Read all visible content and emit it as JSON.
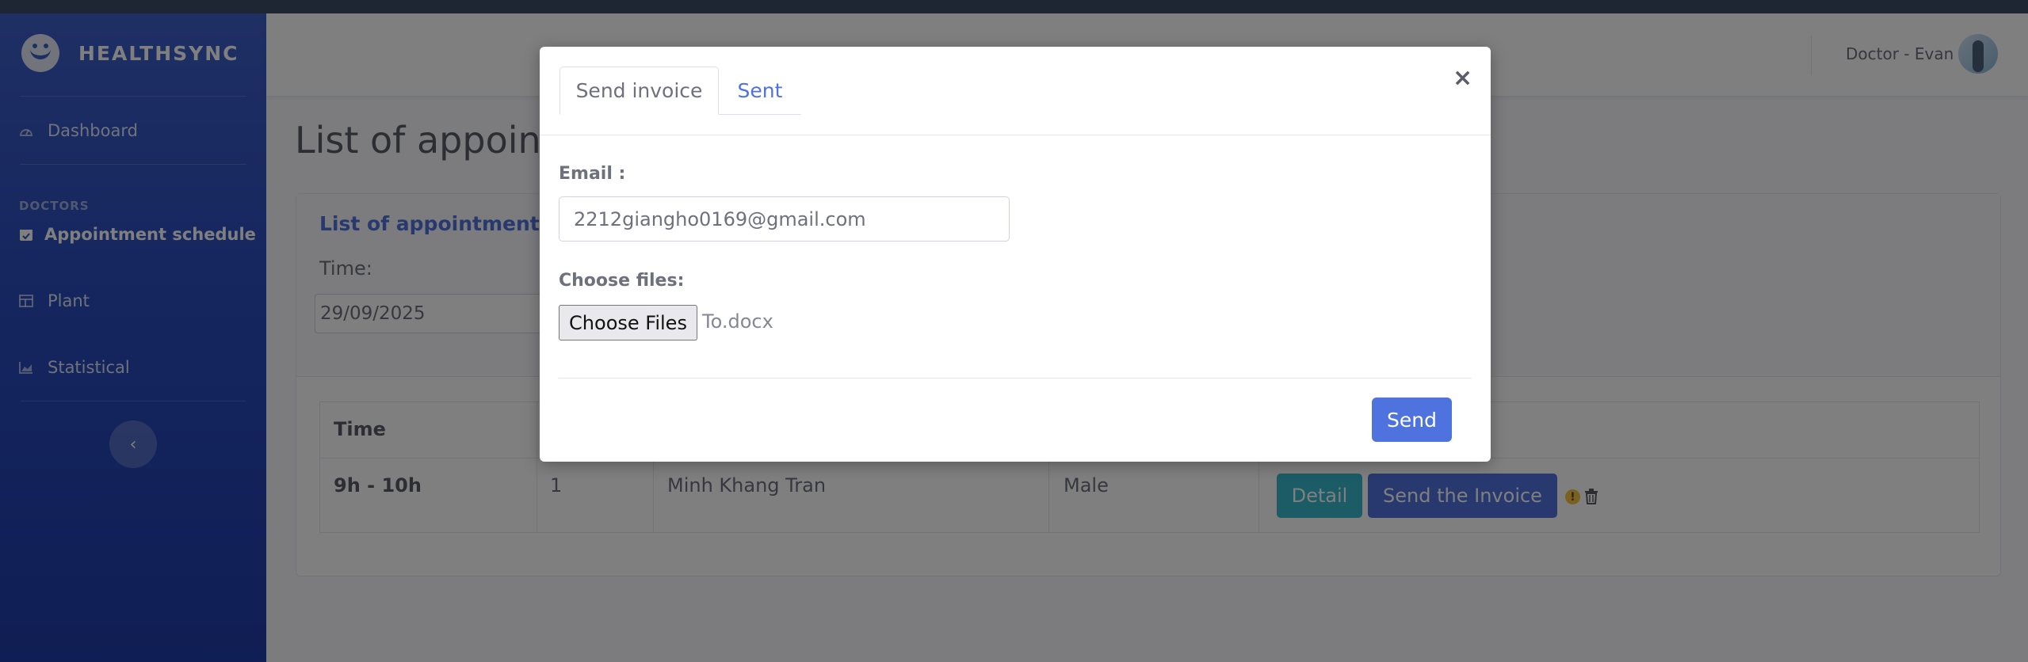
{
  "brand": {
    "name": "HEALTHSYNC"
  },
  "sidebar": {
    "dashboard": "Dashboard",
    "heading": "DOCTORS",
    "appointment": "Appointment schedule",
    "plant": "Plant",
    "statistical": "Statistical",
    "toggle": "‹"
  },
  "topbar": {
    "user": "Doctor - Evan"
  },
  "main": {
    "title": "List of appointm",
    "card_title": "List of appointment ap",
    "time_label": "Time:",
    "date_value": "29/09/2025"
  },
  "table": {
    "header_time": "Time",
    "row": {
      "time": "9h - 10h",
      "number": "1",
      "name": "Minh Khang Tran",
      "gender": "Male",
      "detail": "Detail",
      "invoice": "Send the Invoice"
    }
  },
  "modal": {
    "tab_send": "Send invoice",
    "tab_sent": "Sent",
    "close": "×",
    "email_label": "Email :",
    "email_value": "2212giangho0169@gmail.com",
    "files_label": "Choose files:",
    "choose_button": "Choose Files",
    "file_name": "To.docx",
    "send": "Send"
  },
  "colors": {
    "primary": "#4e73df",
    "info": "#36b9cc",
    "warning": "#f6c23e"
  }
}
